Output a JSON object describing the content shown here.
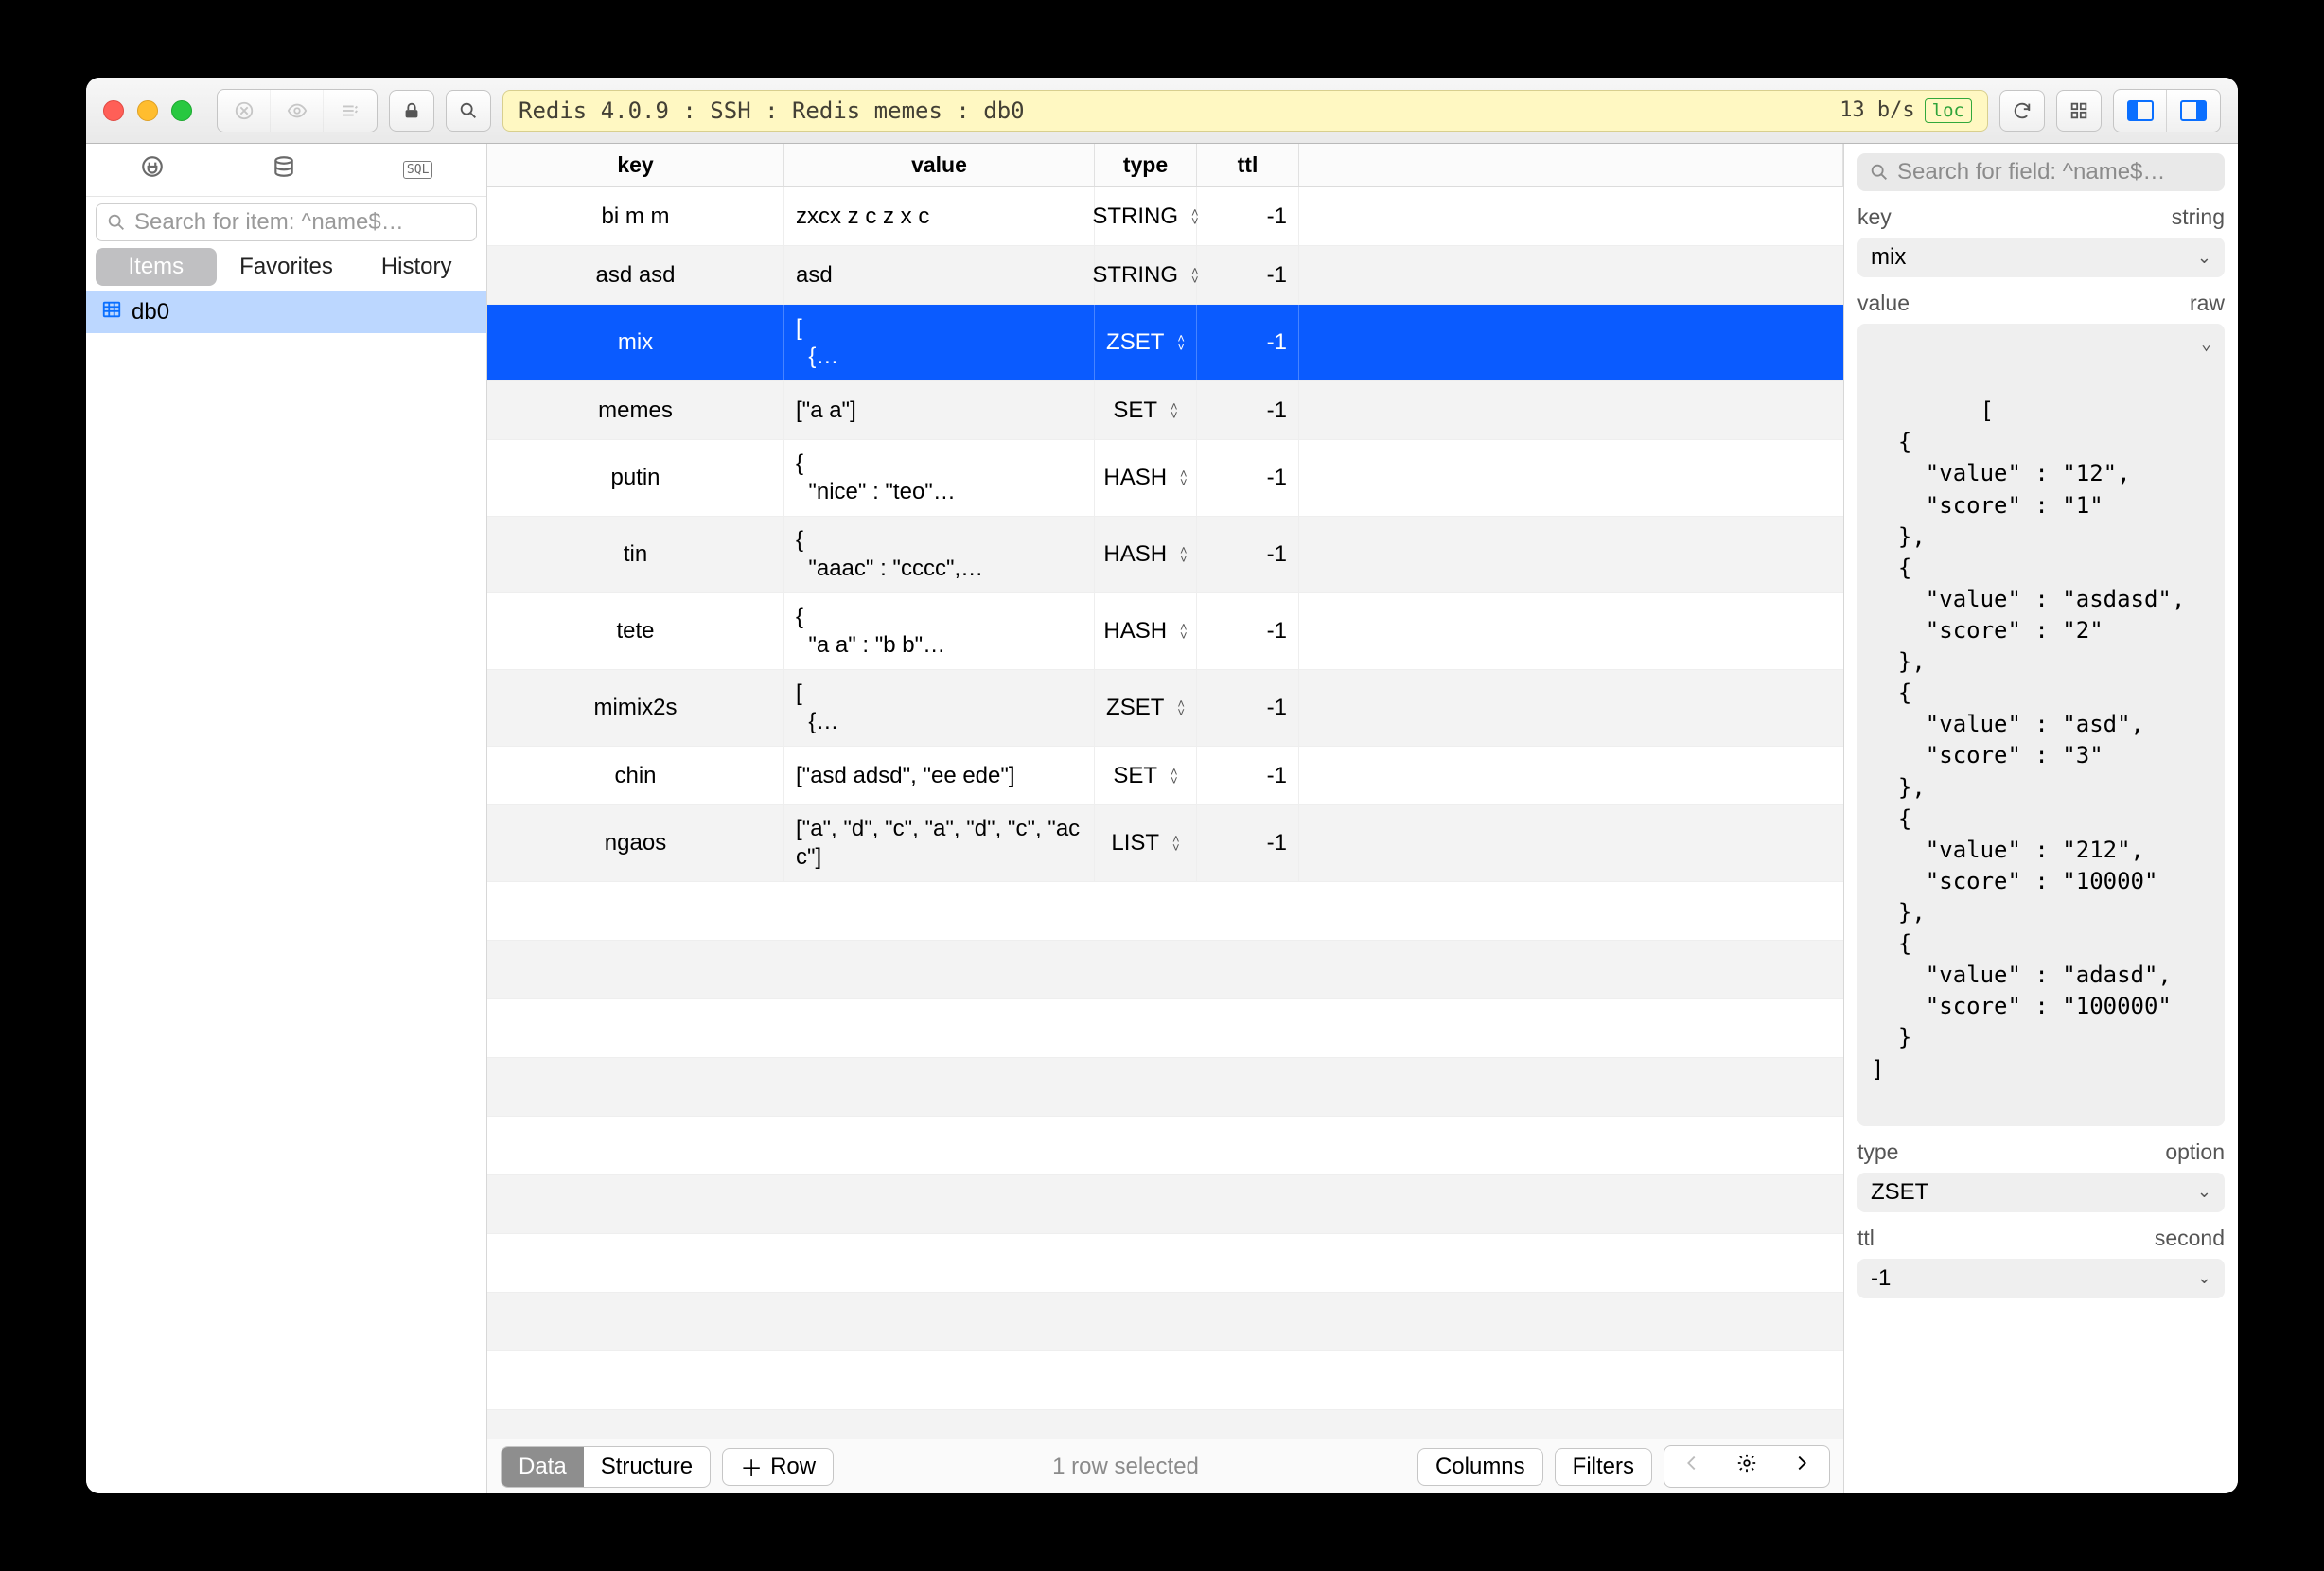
{
  "titlebar": {
    "breadcrumb": "Redis 4.0.9 : SSH : Redis memes : db0",
    "throughput": "13 b/s",
    "loc_badge": "loc"
  },
  "sidebar": {
    "search_placeholder": "Search for item: ^name$…",
    "tabs": [
      "Items",
      "Favorites",
      "History"
    ],
    "active_tab": 0,
    "items": [
      {
        "label": "db0",
        "selected": true
      }
    ]
  },
  "table": {
    "columns": [
      "key",
      "value",
      "type",
      "ttl"
    ],
    "rows": [
      {
        "key": "bi m m",
        "value": "zxcx z c z x c",
        "type": "STRING",
        "ttl": "-1"
      },
      {
        "key": "asd asd",
        "value": "asd",
        "type": "STRING",
        "ttl": "-1"
      },
      {
        "key": "mix",
        "value": "[\n  {…",
        "type": "ZSET",
        "ttl": "-1",
        "selected": true
      },
      {
        "key": "memes",
        "value": "[\"a a\"]",
        "type": "SET",
        "ttl": "-1"
      },
      {
        "key": "putin",
        "value": "{\n  \"nice\" : \"teo\"…",
        "type": "HASH",
        "ttl": "-1"
      },
      {
        "key": "tin",
        "value": "{\n  \"aaac\" : \"cccc\",…",
        "type": "HASH",
        "ttl": "-1"
      },
      {
        "key": "tete",
        "value": "{\n  \"a a\" : \"b b\"…",
        "type": "HASH",
        "ttl": "-1"
      },
      {
        "key": "mimix2s",
        "value": "[\n  {…",
        "type": "ZSET",
        "ttl": "-1"
      },
      {
        "key": "chin",
        "value": "[\"asd adsd\", \"ee ede\"]",
        "type": "SET",
        "ttl": "-1"
      },
      {
        "key": "ngaos",
        "value": "[\"a\", \"d\", \"c\", \"a\", \"d\", \"c\", \"ac c\"]",
        "type": "LIST",
        "ttl": "-1"
      }
    ],
    "empty_rows": 10
  },
  "bottombar": {
    "mode_tabs": [
      "Data",
      "Structure"
    ],
    "mode_active": 0,
    "add_row": "Row",
    "status": "1 row selected",
    "columns_btn": "Columns",
    "filters_btn": "Filters"
  },
  "inspector": {
    "search_placeholder": "Search for field: ^name$…",
    "labels": {
      "key": "key",
      "key_hint": "string",
      "value": "value",
      "value_hint": "raw",
      "type": "type",
      "type_hint": "option",
      "ttl": "ttl",
      "ttl_hint": "second"
    },
    "key_value": "mix",
    "type_value": "ZSET",
    "ttl_value": "-1",
    "raw_value": "[\n  {\n    \"value\" : \"12\",\n    \"score\" : \"1\"\n  },\n  {\n    \"value\" : \"asdasd\",\n    \"score\" : \"2\"\n  },\n  {\n    \"value\" : \"asd\",\n    \"score\" : \"3\"\n  },\n  {\n    \"value\" : \"212\",\n    \"score\" : \"10000\"\n  },\n  {\n    \"value\" : \"adasd\",\n    \"score\" : \"100000\"\n  }\n]"
  }
}
